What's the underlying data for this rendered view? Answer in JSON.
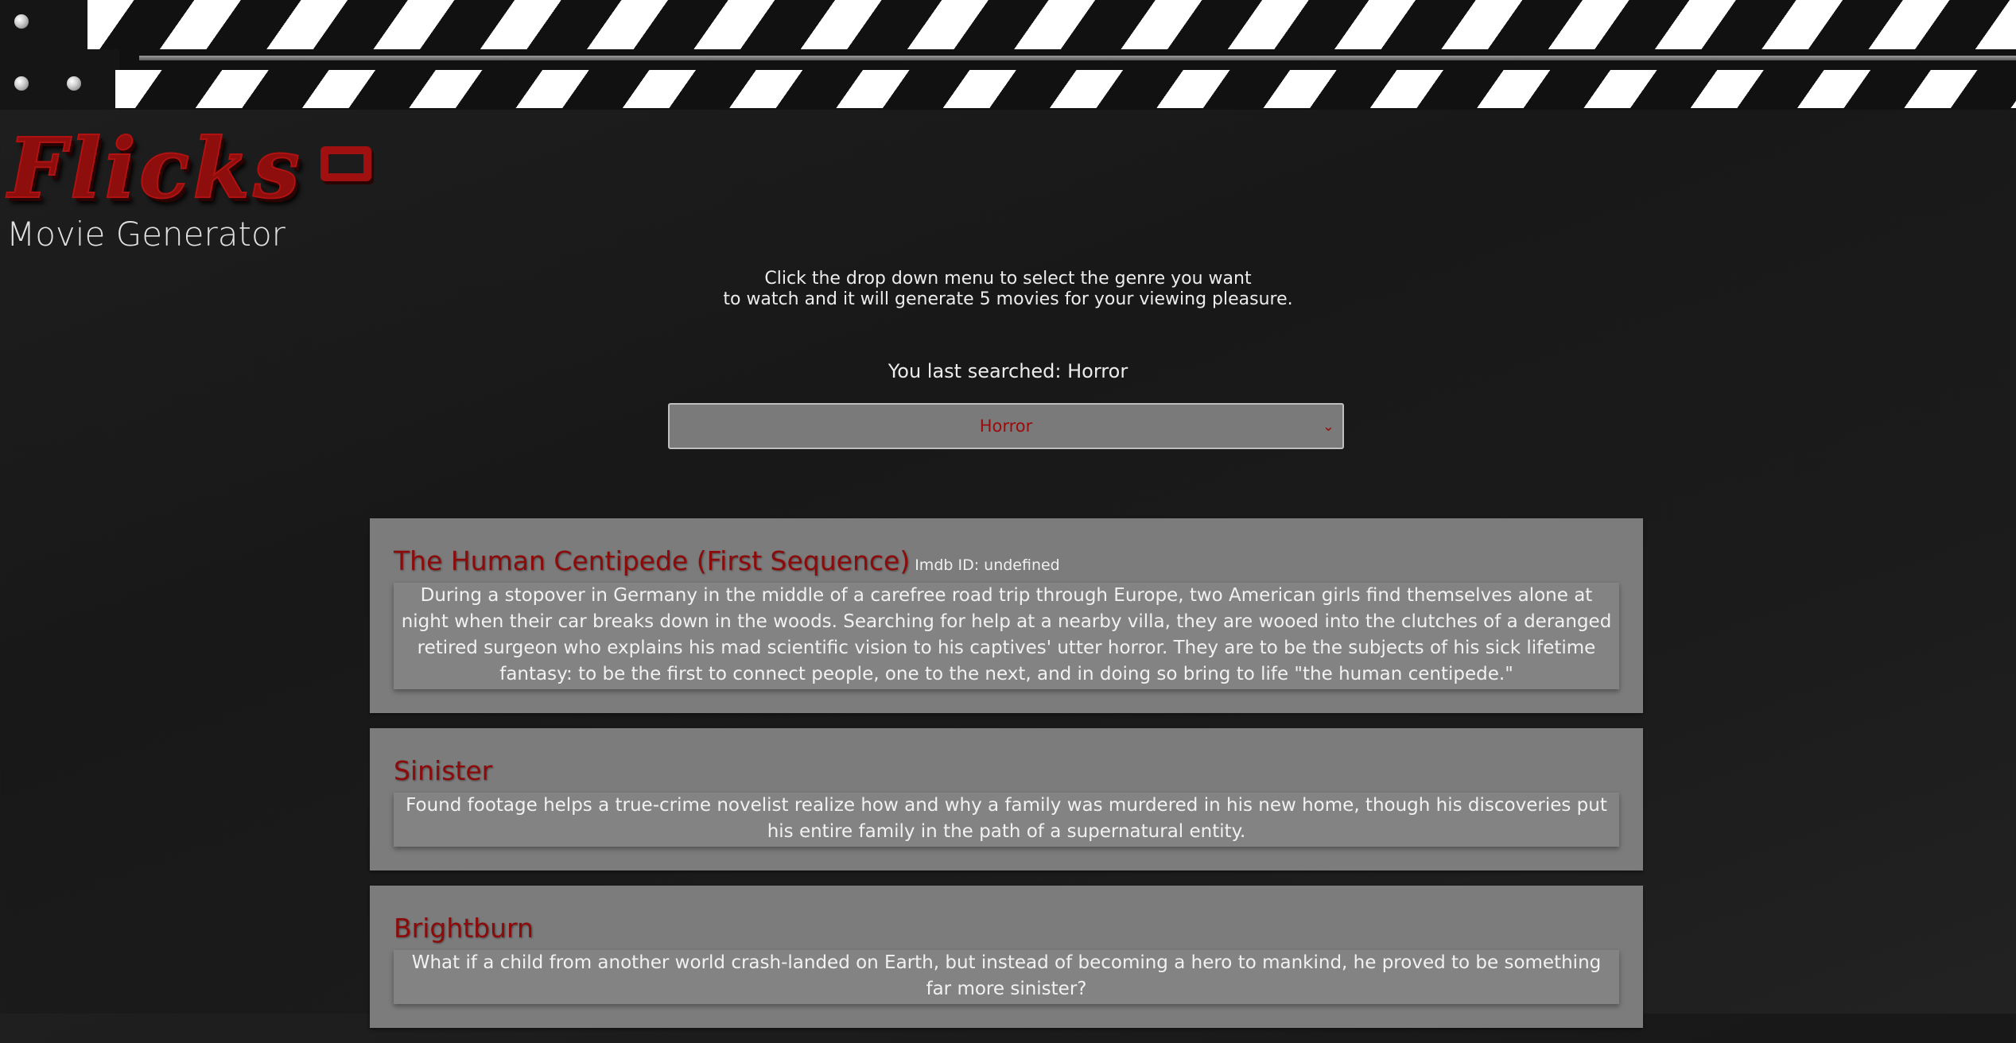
{
  "header": {
    "logo_text": "Flicks",
    "subtitle": "Movie Generator"
  },
  "instructions": {
    "line1": "Click the drop down menu to select the genre you want",
    "line2": "to watch and it will generate 5 movies for your viewing pleasure."
  },
  "last_searched": "You last searched: Horror",
  "genre_select": {
    "selected": "Horror"
  },
  "movies": [
    {
      "title": "The Human Centipede (First Sequence)",
      "imdb": "Imdb ID: undefined",
      "description": "During a stopover in Germany in the middle of a carefree road trip through Europe, two American girls find themselves alone at night when their car breaks down in the woods. Searching for help at a nearby villa, they are wooed into the clutches of a deranged retired surgeon who explains his mad scientific vision to his captives' utter horror. They are to be the subjects of his sick lifetime fantasy: to be the first to connect people, one to the next, and in doing so bring to life \"the human centipede.\""
    },
    {
      "title": "Sinister",
      "description": "Found footage helps a true-crime novelist realize how and why a family was murdered in his new home, though his discoveries put his entire family in the path of a supernatural entity."
    },
    {
      "title": "Brightburn",
      "description": "What if a child from another world crash-landed on Earth, but instead of becoming a hero to mankind, he proved to be something far more sinister?"
    }
  ],
  "colors": {
    "accent_red": "#8c0a0a",
    "card_bg": "#7c7c7c",
    "page_bg": "#1b1b1b"
  }
}
